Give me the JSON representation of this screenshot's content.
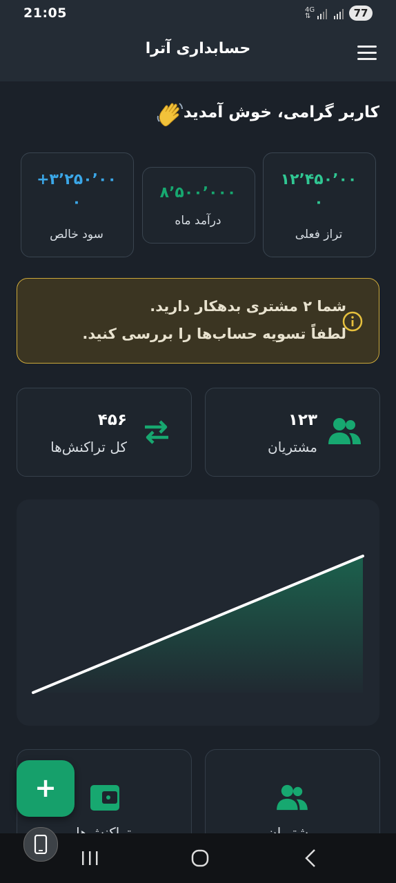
{
  "status_bar": {
    "time": "21:05",
    "network": "4G",
    "battery": "77"
  },
  "app_bar": {
    "title": "حسابداری آترا"
  },
  "welcome": {
    "text": "کاربر گرامی، خوش آمدید"
  },
  "stats": [
    {
      "label": "تراز فعلی",
      "value_line1": "۱۲٬۴۵۰٬۰۰",
      "value_line2": "۰",
      "color": "#30c793"
    },
    {
      "label": "درآمد ماه",
      "value_line1": "۸٬۵۰۰٬۰۰۰",
      "value_line2": "",
      "color": "#17a870"
    },
    {
      "label": "سود خالص",
      "value_line1": "+۳٬۲۵۰٬۰۰",
      "value_line2": "۰",
      "color": "#3ba7e8"
    }
  ],
  "alert": {
    "line1": "شما ۲ مشتری بدهکار دارید.",
    "line2": "لطفاً تسویه حساب‌ها را بررسی کنید.",
    "color": "#cda93a"
  },
  "counts": [
    {
      "label": "مشتریان",
      "value": "۱۲۳",
      "icon": "users-icon"
    },
    {
      "label": "کل تراکنش‌ها",
      "value": "۴۵۶",
      "icon": "swap-icon"
    }
  ],
  "chart_data": {
    "type": "area",
    "x": [
      0,
      1
    ],
    "series": [
      {
        "values": [
          0,
          1
        ]
      }
    ],
    "grid": false
  },
  "bottom_cards": [
    {
      "label": "مشتریان",
      "icon": "users-icon"
    },
    {
      "label": "تراکنش‌ها",
      "icon": "wallet-icon"
    }
  ],
  "fab": {
    "label": "+"
  },
  "accent": "#16a06b"
}
